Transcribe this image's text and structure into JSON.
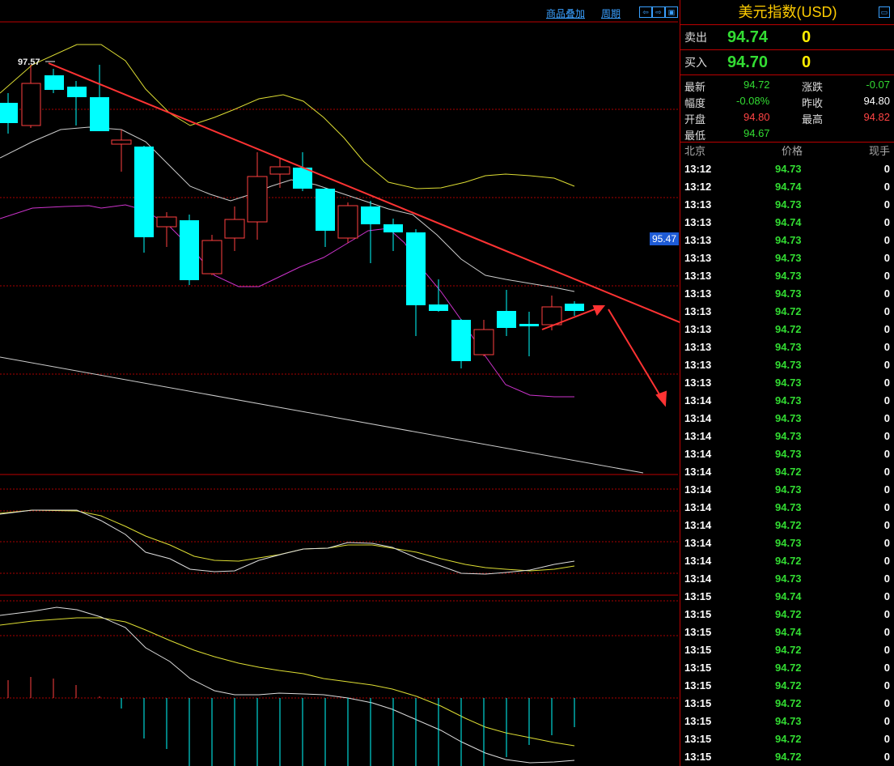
{
  "toolbar": {
    "overlay_label": "商品叠加",
    "period_label": "周期"
  },
  "chart": {
    "high_marker": "97.57",
    "price_tag": "95.47"
  },
  "quote": {
    "title": "美元指数(USD)",
    "ask_label": "卖出",
    "ask_price": "94.74",
    "ask_volume": "0",
    "bid_label": "买入",
    "bid_price": "94.70",
    "bid_volume": "0",
    "latest_label": "最新",
    "latest_value": "94.72",
    "change_label": "涨跌",
    "change_value": "-0.07",
    "range_label": "幅度",
    "range_value": "-0.08%",
    "prev_close_label": "昨收",
    "prev_close_value": "94.80",
    "open_label": "开盘",
    "open_value": "94.80",
    "high_label": "最高",
    "high_value": "94.82",
    "low_label": "最低",
    "low_value": "94.67"
  },
  "trades": {
    "col_time": "北京",
    "col_price": "价格",
    "col_volume": "现手",
    "rows": [
      {
        "time": "13:12",
        "price": "94.73",
        "volume": "0"
      },
      {
        "time": "13:12",
        "price": "94.74",
        "volume": "0"
      },
      {
        "time": "13:13",
        "price": "94.73",
        "volume": "0"
      },
      {
        "time": "13:13",
        "price": "94.74",
        "volume": "0"
      },
      {
        "time": "13:13",
        "price": "94.73",
        "volume": "0"
      },
      {
        "time": "13:13",
        "price": "94.73",
        "volume": "0"
      },
      {
        "time": "13:13",
        "price": "94.73",
        "volume": "0"
      },
      {
        "time": "13:13",
        "price": "94.73",
        "volume": "0"
      },
      {
        "time": "13:13",
        "price": "94.72",
        "volume": "0"
      },
      {
        "time": "13:13",
        "price": "94.72",
        "volume": "0"
      },
      {
        "time": "13:13",
        "price": "94.73",
        "volume": "0"
      },
      {
        "time": "13:13",
        "price": "94.73",
        "volume": "0"
      },
      {
        "time": "13:13",
        "price": "94.73",
        "volume": "0"
      },
      {
        "time": "13:14",
        "price": "94.73",
        "volume": "0"
      },
      {
        "time": "13:14",
        "price": "94.73",
        "volume": "0"
      },
      {
        "time": "13:14",
        "price": "94.73",
        "volume": "0"
      },
      {
        "time": "13:14",
        "price": "94.73",
        "volume": "0"
      },
      {
        "time": "13:14",
        "price": "94.72",
        "volume": "0"
      },
      {
        "time": "13:14",
        "price": "94.73",
        "volume": "0"
      },
      {
        "time": "13:14",
        "price": "94.73",
        "volume": "0"
      },
      {
        "time": "13:14",
        "price": "94.72",
        "volume": "0"
      },
      {
        "time": "13:14",
        "price": "94.73",
        "volume": "0"
      },
      {
        "time": "13:14",
        "price": "94.72",
        "volume": "0"
      },
      {
        "time": "13:14",
        "price": "94.73",
        "volume": "0"
      },
      {
        "time": "13:15",
        "price": "94.74",
        "volume": "0"
      },
      {
        "time": "13:15",
        "price": "94.72",
        "volume": "0"
      },
      {
        "time": "13:15",
        "price": "94.74",
        "volume": "0"
      },
      {
        "time": "13:15",
        "price": "94.72",
        "volume": "0"
      },
      {
        "time": "13:15",
        "price": "94.72",
        "volume": "0"
      },
      {
        "time": "13:15",
        "price": "94.72",
        "volume": "0"
      },
      {
        "time": "13:15",
        "price": "94.72",
        "volume": "0"
      },
      {
        "time": "13:15",
        "price": "94.73",
        "volume": "0"
      },
      {
        "time": "13:15",
        "price": "94.72",
        "volume": "0"
      },
      {
        "time": "13:15",
        "price": "94.72",
        "volume": "0"
      }
    ]
  },
  "colors": {
    "background": "#000000",
    "grid": "#b00000",
    "up_candle": "#ff4040",
    "down_candle": "#00ffff",
    "green_price": "#33dd33",
    "red_price": "#ff4444",
    "title_yellow": "#ffcc00",
    "trend_arrow": "#ff3333"
  }
}
